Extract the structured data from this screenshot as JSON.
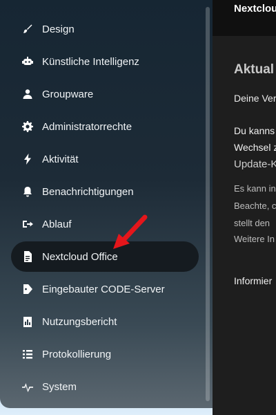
{
  "sidebar": {
    "items": [
      {
        "label": "Design",
        "icon": "brush-icon",
        "active": false
      },
      {
        "label": "Künstliche Intelligenz",
        "icon": "robot-icon",
        "active": false
      },
      {
        "label": "Groupware",
        "icon": "people-icon",
        "active": false
      },
      {
        "label": "Administratorrechte",
        "icon": "cog-icon",
        "active": false
      },
      {
        "label": "Aktivität",
        "icon": "lightning-icon",
        "active": false
      },
      {
        "label": "Benachrichtigungen",
        "icon": "bell-icon",
        "active": false
      },
      {
        "label": "Ablauf",
        "icon": "flow-icon",
        "active": false
      },
      {
        "label": "Nextcloud Office",
        "icon": "document-icon",
        "active": true
      },
      {
        "label": "Eingebauter CODE-Server",
        "icon": "tag-icon",
        "active": false
      },
      {
        "label": "Nutzungsbericht",
        "icon": "report-icon",
        "active": false
      },
      {
        "label": "Protokollierung",
        "icon": "list-icon",
        "active": false
      },
      {
        "label": "System",
        "icon": "pulse-icon",
        "active": false
      }
    ]
  },
  "main": {
    "header_title": "Nextclou",
    "section_heading": "Aktual",
    "info_text": "Deine Ver",
    "strong_lines": [
      "Du kanns",
      "Wechsel z"
    ],
    "link_line": "Update-K",
    "muted_lines": [
      "Es kann in",
      "Beachte, c",
      "stellt den",
      "Weitere In"
    ],
    "footer_text": "Informier"
  },
  "colors": {
    "active_item_bg": "#151b20",
    "annotation_arrow": "#e4161b"
  }
}
